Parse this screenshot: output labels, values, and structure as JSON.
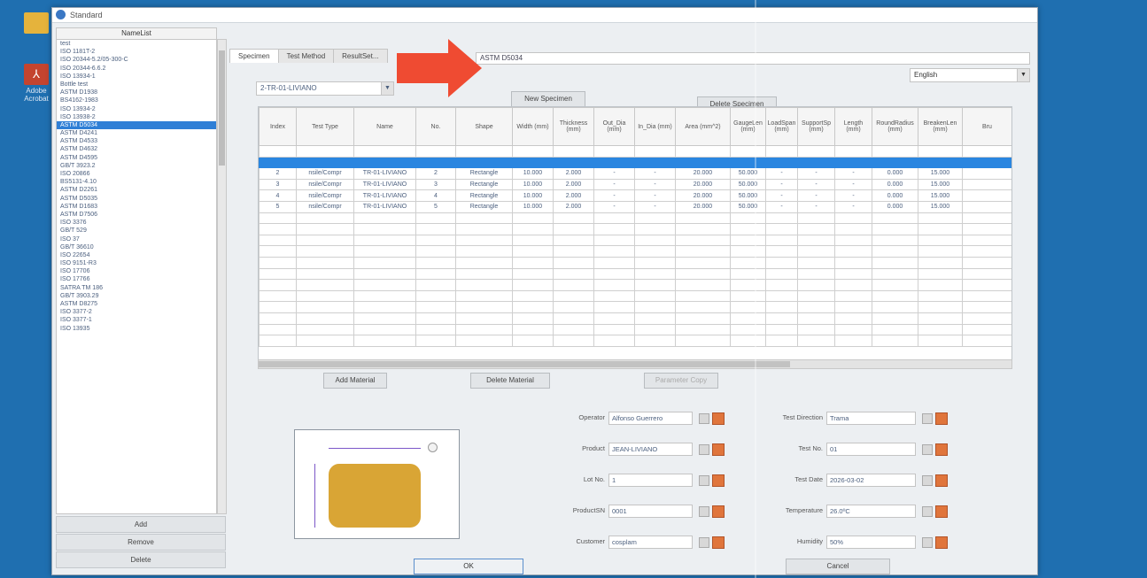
{
  "window": {
    "title": "Standard",
    "name_header": "NameList",
    "names": [
      "test",
      "ISO 1181T-2",
      "ISO 20344-5.2/05-300-C",
      "ISO 20344-6.6.2",
      "ISO 13934-1",
      "Bottle test",
      "ASTM D1938",
      "BS4162-1983",
      "ISO 13934-2",
      "ISO 13938-2",
      "ASTM D5034",
      "ASTM D4241",
      "ASTM D4533",
      "ASTM D4632",
      "ASTM D4595",
      "GB/T 3923.2",
      "ISO 20866",
      "BS5131-4.10",
      "ASTM D2261",
      "ASTM D5035",
      "ASTM D1683",
      "ASTM D7506",
      "ISO 3376",
      "GB/T 529",
      "ISO 37",
      "GB/T 36610",
      "ISO 22654",
      "ISO 9151-R3",
      "ISO 17706",
      "ISO 17766",
      "SATRA TM 186",
      "GB/T 3903.29",
      "ASTM D8275",
      "ISO 3377-2",
      "ISO 3377-1",
      "ISO 13935"
    ],
    "selected_index": 10,
    "buttons": {
      "add": "Add",
      "remove": "Remove",
      "delete": "Delete"
    }
  },
  "desktop": {
    "pdf_label": "Adobe Acrobat"
  },
  "tabs": [
    "Specimen",
    "Test Method",
    "ResultSet..."
  ],
  "standard_name": "ASTM D5034",
  "language": "English",
  "material": "2-TR-01-LIVIANO",
  "actions": {
    "new_specimen": "New Specimen",
    "delete_specimen": "Delete Specimen"
  },
  "grid": {
    "headers": [
      "Index",
      "Test Type",
      "Name",
      "No.",
      "Shape",
      "Width (mm)",
      "Thickness (mm)",
      "Out_Dia (mm)",
      "In_Dia (mm)",
      "Area (mm^2)",
      "GaugeLen (mm)",
      "LoadSpan (mm)",
      "SupportSp (mm)",
      "Length (mm)",
      "RoundRadius (mm)",
      "BreakenLen (mm)",
      "Bru"
    ],
    "rows": [
      [
        "2",
        "nsile/Compr",
        "TR-01-LIVIANO",
        "2",
        "Rectangle",
        "10.000",
        "2.000",
        "-",
        "-",
        "20.000",
        "50.000",
        "-",
        "-",
        "-",
        "0.000",
        "15.000",
        ""
      ],
      [
        "3",
        "nsile/Compr",
        "TR-01-LIVIANO",
        "3",
        "Rectangle",
        "10.000",
        "2.000",
        "-",
        "-",
        "20.000",
        "50.000",
        "-",
        "-",
        "-",
        "0.000",
        "15.000",
        ""
      ],
      [
        "4",
        "nsile/Compr",
        "TR-01-LIVIANO",
        "4",
        "Rectangle",
        "10.000",
        "2.000",
        "-",
        "-",
        "20.000",
        "50.000",
        "-",
        "-",
        "-",
        "0.000",
        "15.000",
        ""
      ],
      [
        "5",
        "nsile/Compr",
        "TR-01-LIVIANO",
        "5",
        "Rectangle",
        "10.000",
        "2.000",
        "-",
        "-",
        "20.000",
        "50.000",
        "-",
        "-",
        "-",
        "0.000",
        "15.000",
        ""
      ]
    ]
  },
  "material_buttons": {
    "add": "Add Material",
    "delete": "Delete Material",
    "param_copy": "Parameter Copy"
  },
  "fields_left": [
    {
      "label": "Operator",
      "value": "Alfonso Guerrero"
    },
    {
      "label": "Product",
      "value": "JEAN-LIVIANO"
    },
    {
      "label": "Lot No.",
      "value": "1"
    },
    {
      "label": "ProductSN",
      "value": "0001"
    },
    {
      "label": "Customer",
      "value": "cosplam"
    }
  ],
  "fields_right": [
    {
      "label": "Test Direction",
      "value": "Trama"
    },
    {
      "label": "Test No.",
      "value": "01"
    },
    {
      "label": "Test Date",
      "value": "2026-03-02"
    },
    {
      "label": "Temperature",
      "value": "26.0ºC"
    },
    {
      "label": "Humidity",
      "value": "50%"
    }
  ],
  "footer": {
    "ok": "OK",
    "cancel": "Cancel"
  },
  "colors": {
    "arrow": "#ef4b32",
    "selection": "#2a86e0",
    "specimen_fill": "#d9a535"
  }
}
